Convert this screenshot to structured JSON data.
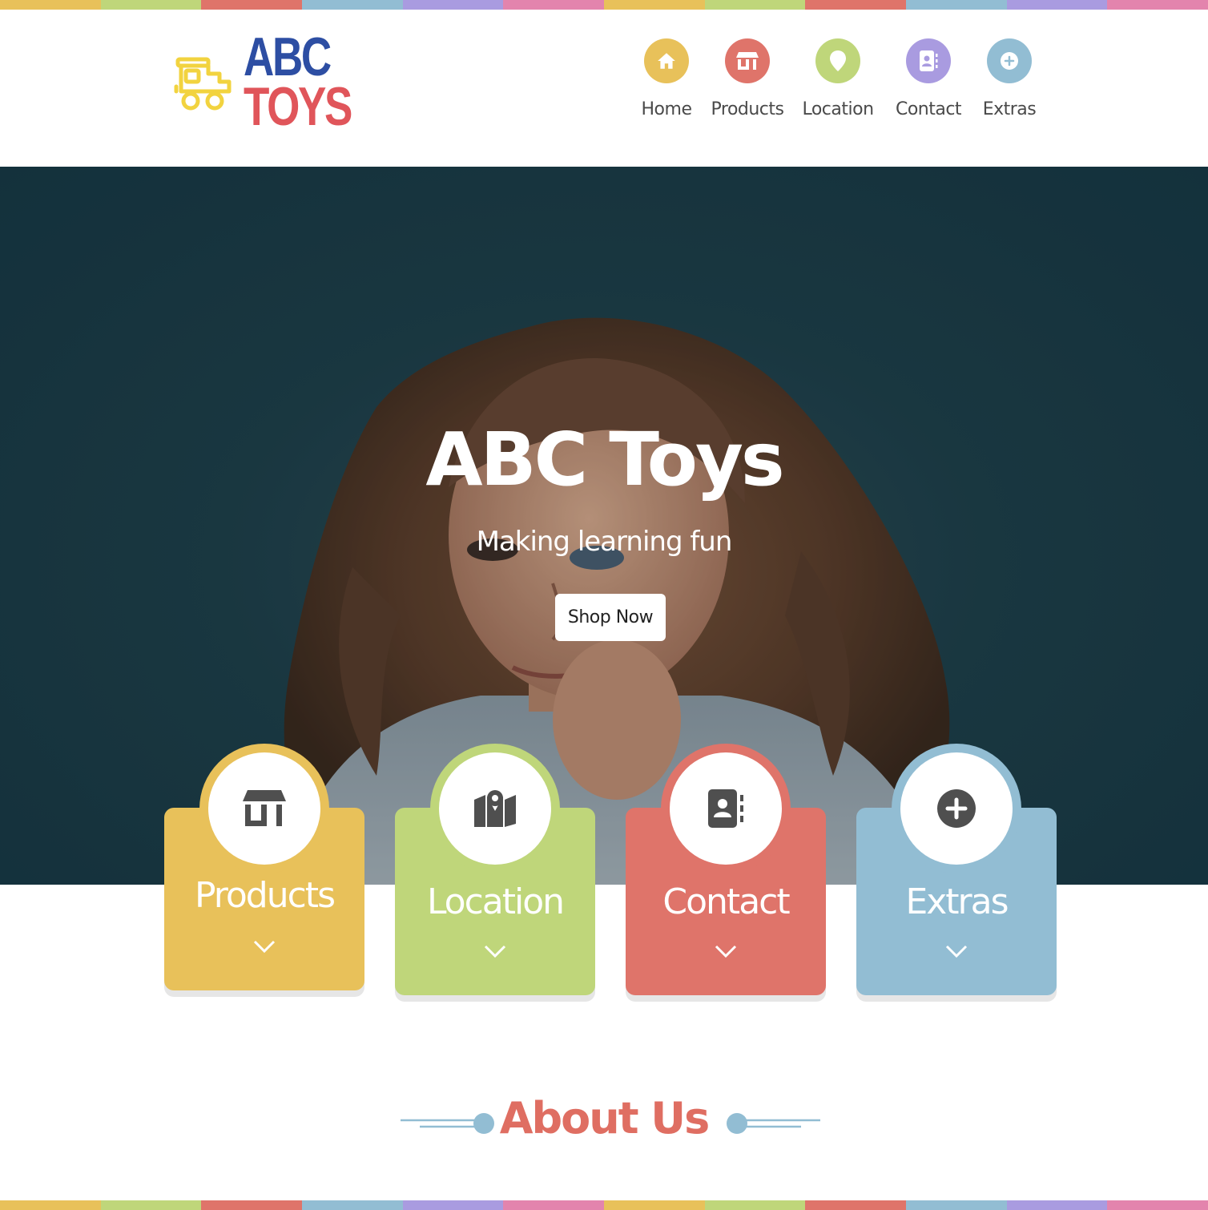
{
  "colors": {
    "yellow": "#e8c15a",
    "green": "#bfd67a",
    "red": "#df746a",
    "blue": "#92bdd3",
    "purple": "#a99be0",
    "pink": "#e384ad",
    "brand_blue": "#2d4ea3",
    "brand_red": "#e0555a"
  },
  "stripe_colors": [
    "#e8c15a",
    "#bfd67a",
    "#df746a",
    "#92bdd3",
    "#a99be0",
    "#e384ad",
    "#e8c15a",
    "#bfd67a",
    "#df746a",
    "#92bdd3",
    "#a99be0",
    "#e384ad"
  ],
  "logo": {
    "line1": "ABC",
    "line2": "TOYS",
    "icon": "train-icon"
  },
  "nav": [
    {
      "label": "Home",
      "icon": "home-icon",
      "color": "#e8c15a"
    },
    {
      "label": "Products",
      "icon": "store-icon",
      "color": "#df746a"
    },
    {
      "label": "Location",
      "icon": "map-pin-icon",
      "color": "#bfd67a"
    },
    {
      "label": "Contact",
      "icon": "address-book-icon",
      "color": "#a99be0"
    },
    {
      "label": "Extras",
      "icon": "plus-circle-icon",
      "color": "#92bdd3"
    }
  ],
  "hero": {
    "title": "ABC Toys",
    "subtitle": "Making learning fun",
    "button": "Shop Now"
  },
  "cards": [
    {
      "label": "Products",
      "icon": "store-icon",
      "color": "#e8c15a"
    },
    {
      "label": "Location",
      "icon": "map-icon",
      "color": "#bfd67a"
    },
    {
      "label": "Contact",
      "icon": "address-book-icon",
      "color": "#df746a"
    },
    {
      "label": "Extras",
      "icon": "plus-circle-icon",
      "color": "#92bdd3"
    }
  ],
  "about": {
    "title": "About Us"
  }
}
